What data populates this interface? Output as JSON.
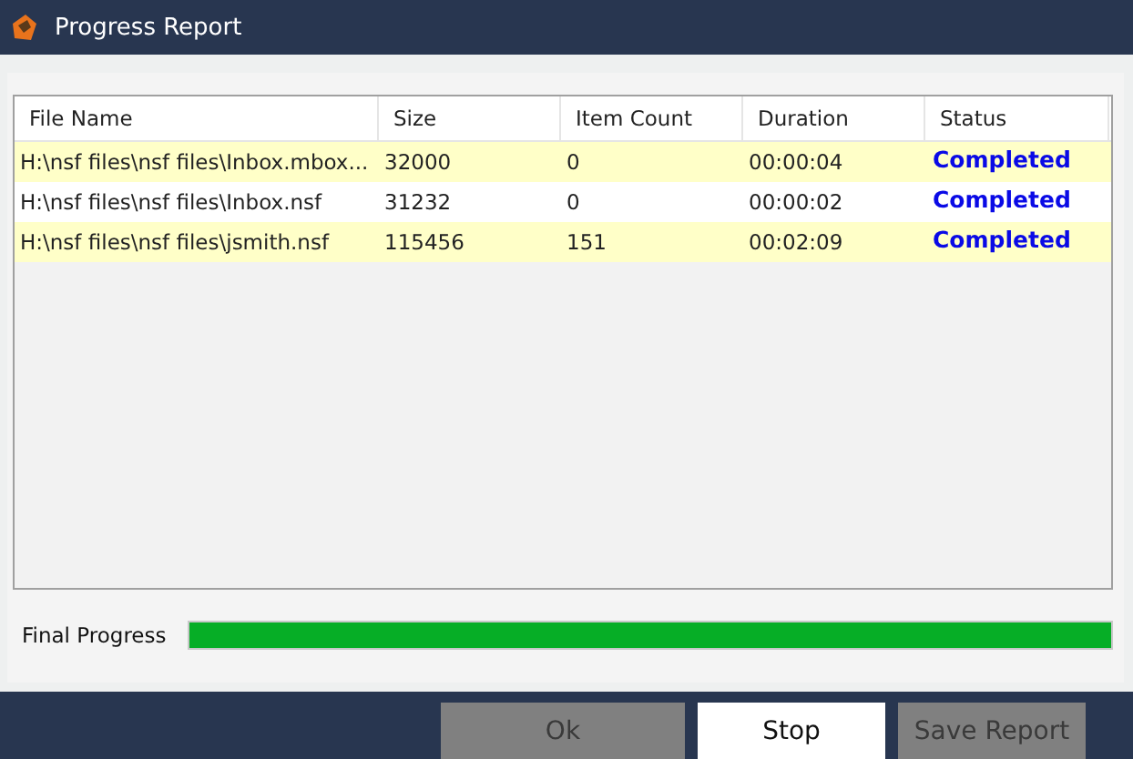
{
  "window": {
    "title": "Progress Report"
  },
  "table": {
    "columns": [
      "File Name",
      "Size",
      "Item Count",
      "Duration",
      "Status"
    ],
    "rows": [
      {
        "cells": [
          "H:\\nsf files\\nsf files\\Inbox.mbox...",
          "32000",
          "0",
          "00:00:04",
          "Completed"
        ]
      },
      {
        "cells": [
          "H:\\nsf files\\nsf files\\Inbox.nsf",
          "31232",
          "0",
          "00:00:02",
          "Completed"
        ]
      },
      {
        "cells": [
          "H:\\nsf files\\nsf files\\jsmith.nsf",
          "115456",
          "151",
          "00:02:09",
          "Completed"
        ]
      }
    ]
  },
  "progress": {
    "label": "Final Progress",
    "level": 1
  },
  "buttons": [
    {
      "label": "Ok",
      "disabled": true
    },
    {
      "label": "Stop",
      "disabled": false
    },
    {
      "label": "Save Report",
      "disabled": true
    }
  ]
}
